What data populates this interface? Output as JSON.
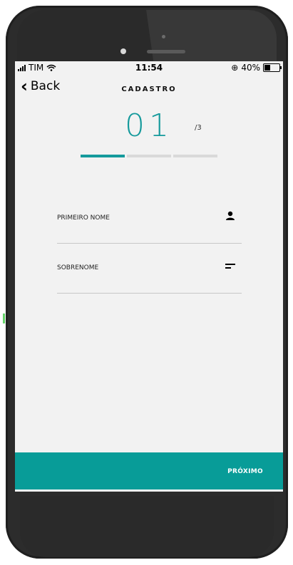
{
  "status": {
    "carrier": "TIM",
    "time": "11:54",
    "battery_percent": "40%",
    "battery_level": 0.4
  },
  "nav": {
    "back_label": "Back",
    "title": "CADASTRO"
  },
  "step": {
    "current": "01",
    "total": "/3",
    "progress_segments": 3,
    "progress_active": 1
  },
  "form": {
    "first_name_label": "PRIMEIRO NOME",
    "last_name_label": "SOBRENOME"
  },
  "footer": {
    "next_label": "PRÓXIMO"
  },
  "colors": {
    "accent": "#159a9c",
    "footer_bg": "#089c98"
  },
  "icons": {
    "first_name": "user-icon",
    "last_name": "text-lines-icon"
  }
}
